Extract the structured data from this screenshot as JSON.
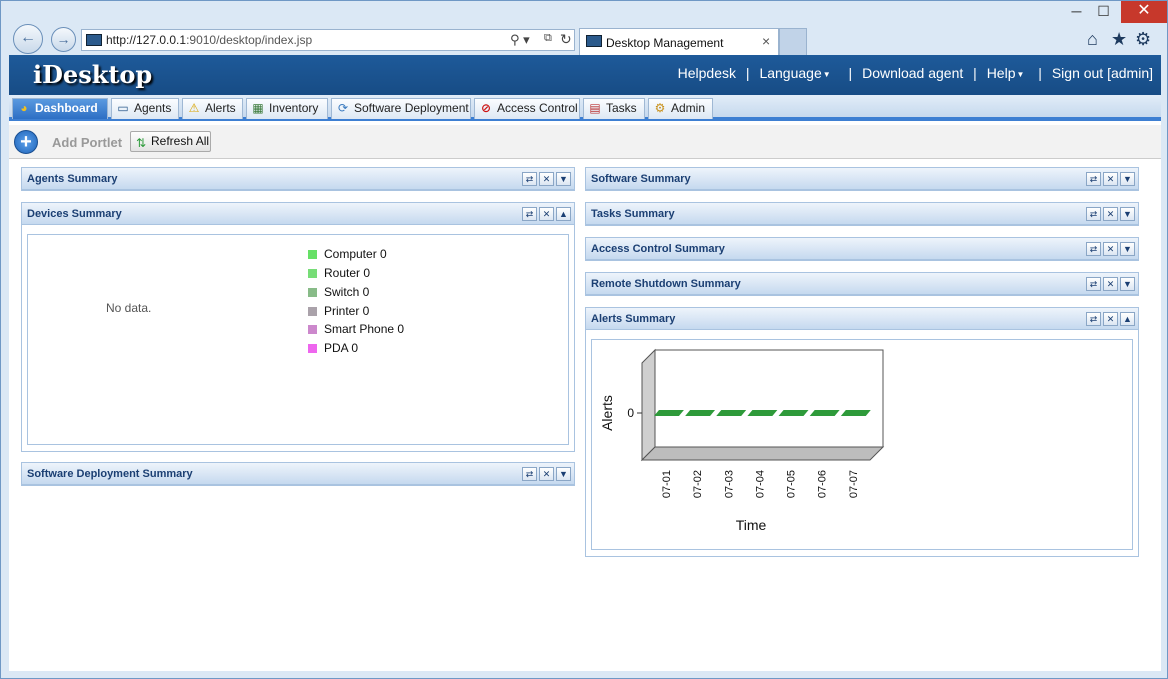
{
  "browser": {
    "url_host": "http://127.0.0.1",
    "url_rest": ":9010/desktop/index.jsp",
    "tab_title": "Desktop Management",
    "tab_close": "×",
    "win_min": "─",
    "win_max": "☐",
    "win_close": "✕",
    "back": "←",
    "forward": "→",
    "search": "⚲ ▾",
    "compat": "⧉",
    "refresh": "↻",
    "home": "⌂",
    "star": "★",
    "gear": "⚙"
  },
  "app": {
    "logo": "iDesktop",
    "header_links": {
      "helpdesk": "Helpdesk",
      "language": "Language",
      "download_agent": "Download agent",
      "help": "Help",
      "sign_out": "Sign out [admin]",
      "sep": "|"
    },
    "tabs": [
      {
        "label": "Dashboard",
        "icon": "dashboard-icon",
        "glyph": "◕"
      },
      {
        "label": "Agents",
        "icon": "monitor-icon",
        "glyph": "▭"
      },
      {
        "label": "Alerts",
        "icon": "warning-icon",
        "glyph": "⚠"
      },
      {
        "label": "Inventory",
        "icon": "inventory-icon",
        "glyph": "▦"
      },
      {
        "label": "Software Deployment",
        "icon": "deployment-icon",
        "glyph": "⟳"
      },
      {
        "label": "Access Control",
        "icon": "no-entry-icon",
        "glyph": "⊘"
      },
      {
        "label": "Tasks",
        "icon": "calendar-icon",
        "glyph": "▤"
      },
      {
        "label": "Admin",
        "icon": "cog-icon",
        "glyph": "⚙"
      }
    ],
    "toolbar": {
      "add_portlet_glyph": "+",
      "add_portlet": "Add Portlet",
      "refresh_all": "Refresh All",
      "refresh_glyph": "⇅"
    },
    "portlet_buttons": {
      "refresh": "⇄",
      "close": "✕",
      "expand": "▼",
      "collapse": "▲"
    },
    "left_portlets": {
      "agents": "Agents Summary",
      "devices": "Devices Summary",
      "software_deployment": "Software Deployment Summary"
    },
    "right_portlets": {
      "software": "Software Summary",
      "tasks": "Tasks Summary",
      "access_control": "Access Control Summary",
      "remote_shutdown": "Remote Shutdown Summary",
      "alerts": "Alerts Summary"
    },
    "devices": {
      "no_data": "No data.",
      "legend": [
        {
          "label": "Computer 0",
          "color": "#66e066"
        },
        {
          "label": "Router 0",
          "color": "#77dd77"
        },
        {
          "label": "Switch 0",
          "color": "#88bb88"
        },
        {
          "label": "Printer 0",
          "color": "#aaa2aa"
        },
        {
          "label": "Smart Phone 0",
          "color": "#cc88cc"
        },
        {
          "label": "PDA 0",
          "color": "#ee66ee"
        }
      ]
    }
  },
  "chart_data": {
    "type": "bar",
    "categories": [
      "07-01",
      "07-02",
      "07-03",
      "07-04",
      "07-05",
      "07-06",
      "07-07"
    ],
    "values": [
      0,
      0,
      0,
      0,
      0,
      0,
      0
    ],
    "xlabel": "Time",
    "ylabel": "Alerts",
    "yticks": [
      "0"
    ],
    "bar_color": "#2e9a3a",
    "grid": false,
    "style": "3d"
  }
}
